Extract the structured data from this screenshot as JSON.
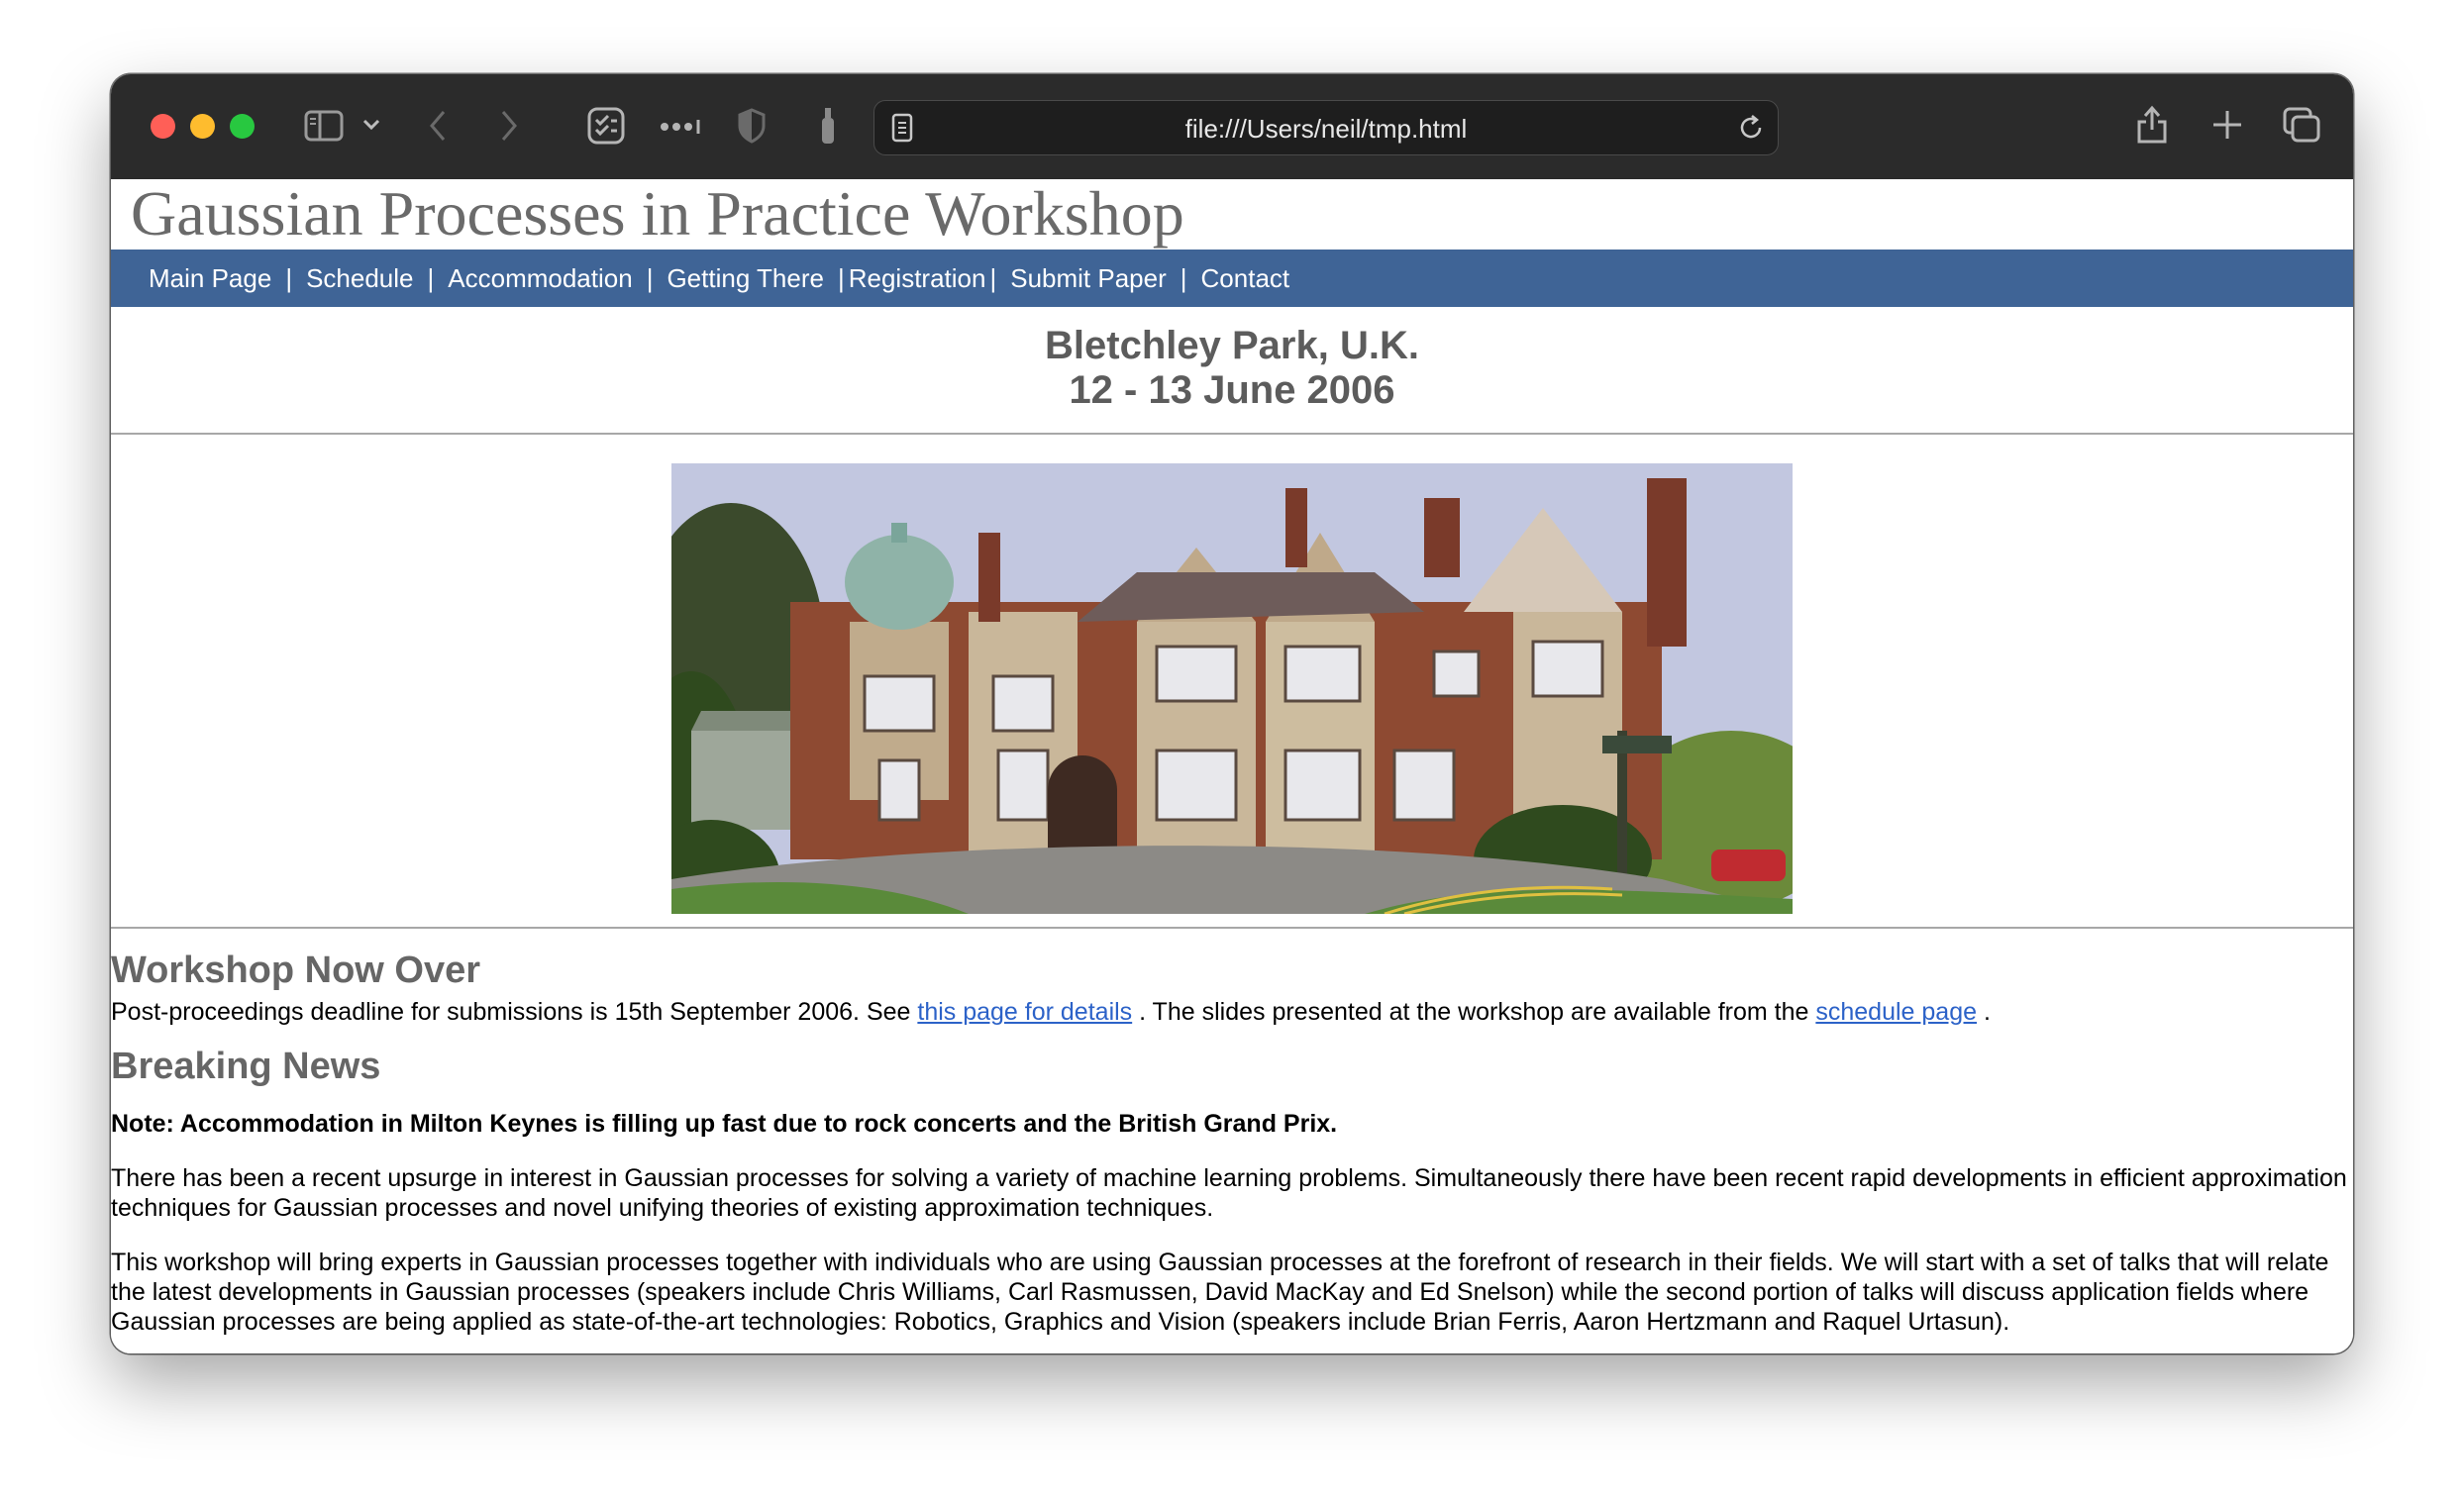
{
  "browser": {
    "url": "file:///Users/neil/tmp.html"
  },
  "site": {
    "title": "Gaussian Processes in Practice Workshop"
  },
  "nav": {
    "items": [
      {
        "label": "Main Page"
      },
      {
        "label": "Schedule"
      },
      {
        "label": "Accommodation"
      },
      {
        "label": "Getting There"
      },
      {
        "label": "Registration"
      },
      {
        "label": "Submit Paper"
      },
      {
        "label": "Contact"
      }
    ],
    "separator": "|"
  },
  "venue": {
    "location": "Bletchley Park, U.K.",
    "dates": "12 - 13 June 2006"
  },
  "sections": {
    "over": {
      "heading": "Workshop Now Over",
      "text_1": "Post-proceedings deadline for submissions is 15th September 2006. See ",
      "link_1": "this page for details",
      "text_2": " . The slides presented at the workshop are available from the ",
      "link_2": "schedule page",
      "text_3": " ."
    },
    "news": {
      "heading": "Breaking News",
      "note": "Note: Accommodation in Milton Keynes is filling up fast due to rock concerts and the British Grand Prix.",
      "para_1": "There has been a recent upsurge in interest in Gaussian processes for solving a variety of machine learning problems. Simultaneously there have been recent rapid developments in efficient approximation techniques for Gaussian processes and novel unifying theories of existing approximation techniques.",
      "para_2": "This workshop will bring experts in Gaussian processes together with individuals who are using Gaussian processes at the forefront of research in their fields. We will start with a set of talks that will relate the latest developments in Gaussian processes (speakers include Chris Williams, Carl Rasmussen, David MacKay and Ed Snelson) while the second portion of talks will discuss application fields where Gaussian processes are being applied as state-of-the-art technologies: Robotics, Graphics and Vision (speakers include Brian Ferris, Aaron Hertzmann and Raquel Urtasun)."
    }
  }
}
